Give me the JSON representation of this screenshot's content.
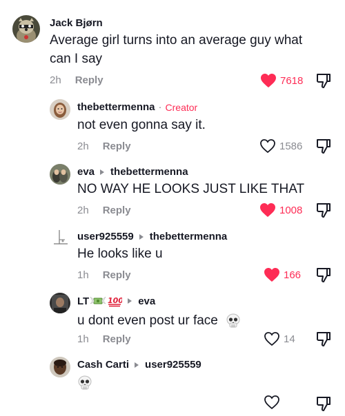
{
  "colors": {
    "accent": "#fe2c55",
    "muted": "#8a8b91",
    "text": "#161823"
  },
  "comments": [
    {
      "username": "Jack Bjørn",
      "text_line1": "Average girl turns into an average guy what",
      "text_line2": "can I say",
      "time": "2h",
      "reply_label": "Reply",
      "likes": "7618",
      "liked": true
    },
    {
      "username": "thebettermenna",
      "separator": "·",
      "badge": "Creator",
      "text": "not even gonna say it.",
      "time": "2h",
      "reply_label": "Reply",
      "likes": "1586",
      "liked": false
    },
    {
      "username": "eva",
      "reply_to": "thebettermenna",
      "text": "NO WAY HE LOOKS JUST LIKE THAT",
      "time": "2h",
      "reply_label": "Reply",
      "likes": "1008",
      "liked": true
    },
    {
      "username": "user925559",
      "reply_to": "thebettermenna",
      "text": "He looks like u",
      "time": "1h",
      "reply_label": "Reply",
      "likes": "166",
      "liked": true
    },
    {
      "username": "LT",
      "username_emojis": [
        "money-with-wings-emoji",
        "hundred-points-emoji"
      ],
      "reply_to": "eva",
      "text": "u dont even post ur face",
      "text_emoji": "skull-emoji",
      "time": "1h",
      "reply_label": "Reply",
      "likes": "14",
      "liked": false
    },
    {
      "username": "Cash Carti",
      "reply_to": "user925559",
      "text_emoji": "skull-emoji"
    }
  ]
}
